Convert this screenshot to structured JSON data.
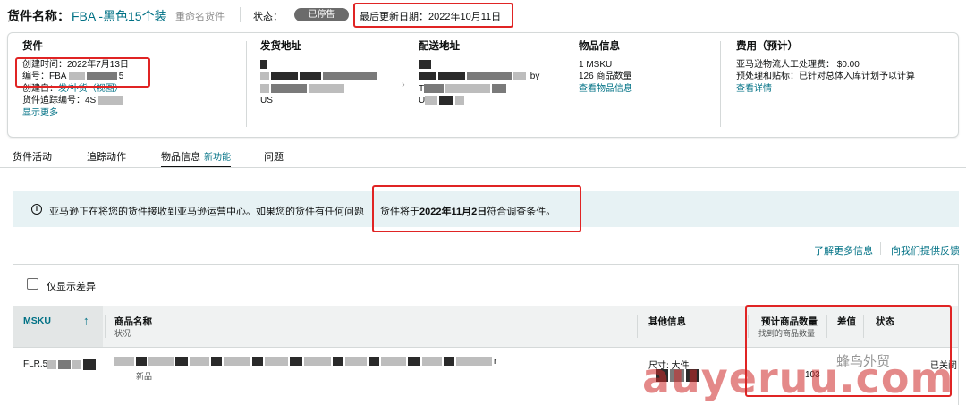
{
  "header": {
    "title_label": "货件名称：",
    "title_value": "FBA -黑色15个装",
    "rename_link": "重命名货件",
    "status_label": "状态：",
    "status_value": "已停售",
    "last_update": "最后更新日期：2022年10月11日"
  },
  "summary": {
    "shipment": {
      "heading": "货件",
      "created": "创建时间：2022年7月13日",
      "number_label": "编号：FBA",
      "number_tail": "5",
      "created_from_label": "创建自：",
      "created_from_link": "发/补货（视图）",
      "tracking_label": "货件追踪编号：4S",
      "show_more": "显示更多"
    },
    "ship_from": {
      "heading": "发货地址",
      "line3": "US"
    },
    "ship_to": {
      "heading": "配送地址",
      "line2_tail": "by",
      "line3_prefix": "T",
      "line4_prefix": "U"
    },
    "items": {
      "heading": "物品信息",
      "msku": "1 MSKU",
      "units": "126 商品数量",
      "link": "查看物品信息"
    },
    "fees": {
      "heading": "费用（预计）",
      "manual_label": "亚马逊物流人工处理费：",
      "manual_value": "$0.00",
      "prep_label": "预处理和贴标：",
      "prep_value": "已针对总体入库计划予以计算",
      "link": "查看详情"
    }
  },
  "tabs": [
    {
      "label": "货件活动"
    },
    {
      "label": "追踪动作"
    },
    {
      "label": "物品信息",
      "badge": "新功能"
    },
    {
      "label": "问题"
    }
  ],
  "alert": {
    "text": "亚马逊正在将您的货件接收到亚马逊运营中心。如果您的货件有任何问题",
    "date_prefix": "货件将于",
    "date_bold": "2022年11月2日",
    "date_suffix": "符合调查条件。"
  },
  "links": {
    "learn_more": "了解更多信息",
    "feedback": "向我们提供反馈"
  },
  "table": {
    "filter_label": "仅显示差异",
    "columns": {
      "msku": "MSKU",
      "product_name": "商品名称",
      "condition": "状况",
      "other_info": "其他信息",
      "expected_qty": "预计商品数量",
      "found_qty": "找到的商品数量",
      "diff": "差值",
      "status": "状态"
    },
    "rows": [
      {
        "msku_prefix": "FLR.5",
        "condition": "新品",
        "name_tail": "r",
        "other_info": "尺寸: 大件",
        "expected": "103",
        "status": "已关闭"
      }
    ]
  },
  "watermark": {
    "text": "auyeruu.com",
    "brand": "蜂鸟外贸"
  },
  "icons": {
    "info": "info-icon",
    "sort": "arrow-up-icon",
    "checkbox": "checkbox-icon"
  },
  "colors": {
    "link": "#007185",
    "highlight": "#e02424",
    "alert_bg": "#e7f2f4",
    "status_pill": "#6b6b6b"
  }
}
